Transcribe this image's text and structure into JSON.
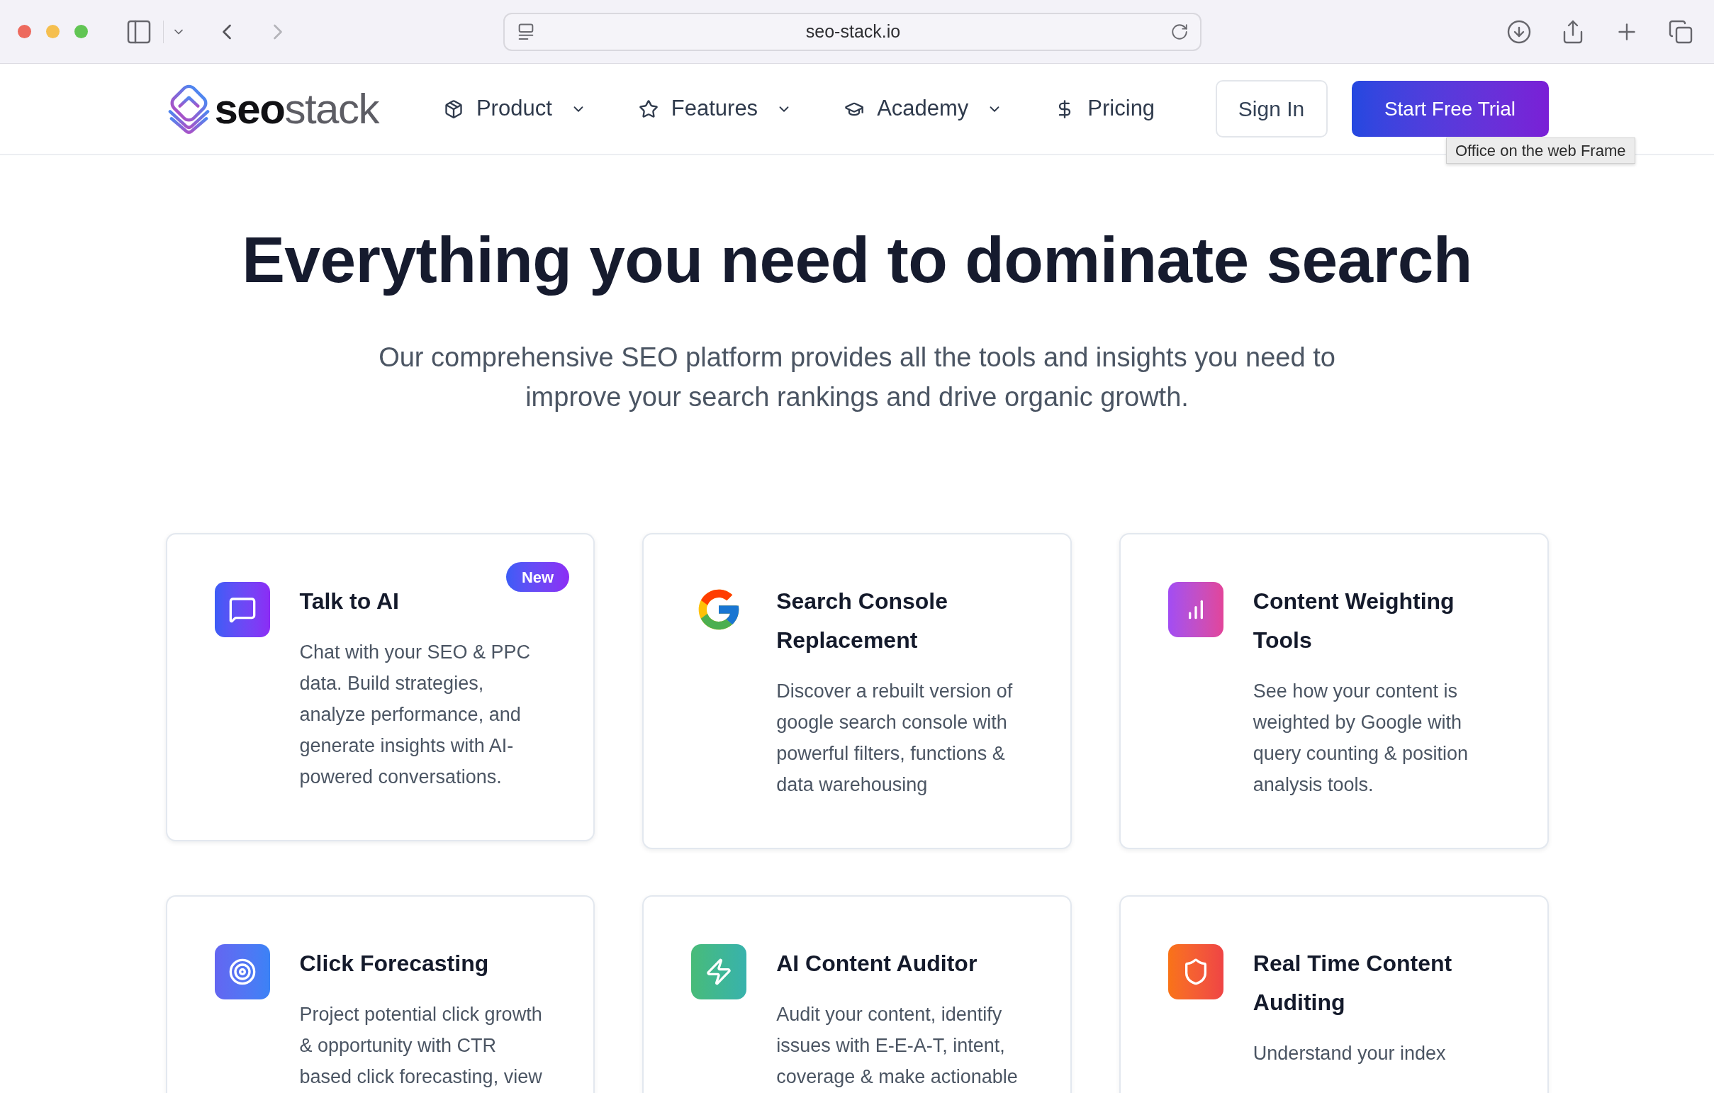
{
  "browser": {
    "history_buttons": [
      {
        "kind": "back",
        "disabled": false
      },
      {
        "kind": "forward",
        "disabled": true
      }
    ],
    "url": "seo-stack.io",
    "tooltip": "Office on the web Frame"
  },
  "header": {
    "logo": {
      "primary": "seo",
      "secondary": "stack"
    },
    "nav_items": [
      {
        "label": "Product",
        "kind": "menu"
      },
      {
        "label": "Features",
        "kind": "menu"
      },
      {
        "label": "Academy",
        "kind": "menu"
      },
      {
        "label": "Pricing",
        "kind": "link"
      }
    ],
    "sign_in": "Sign In",
    "cta": "Start Free Trial"
  },
  "hero": {
    "title": "Everything you need to dominate search",
    "subtitle": "Our comprehensive SEO platform provides all the tools and insights you need to improve your search rankings and drive organic growth."
  },
  "features": [
    {
      "title": "Talk to AI",
      "description": "Chat with your SEO & PPC data. Build strategies, analyze performance, and generate insights with AI-powered conversations.",
      "badge": "New"
    },
    {
      "title": "Search Console Replacement",
      "description": "Discover a rebuilt version of google search console with powerful filters, functions & data warehousing"
    },
    {
      "title": "Content Weighting Tools",
      "description": "See how your content is weighted by Google with query counting & position analysis tools."
    },
    {
      "title": "Click Forecasting",
      "description": "Project potential click growth & opportunity with CTR based click forecasting, view"
    },
    {
      "title": "AI Content Auditor",
      "description": "Audit your content, identify issues with E-E-A-T, intent, coverage & make actionable"
    },
    {
      "title": "Real Time Content Auditing",
      "description": "Understand your index"
    }
  ]
}
